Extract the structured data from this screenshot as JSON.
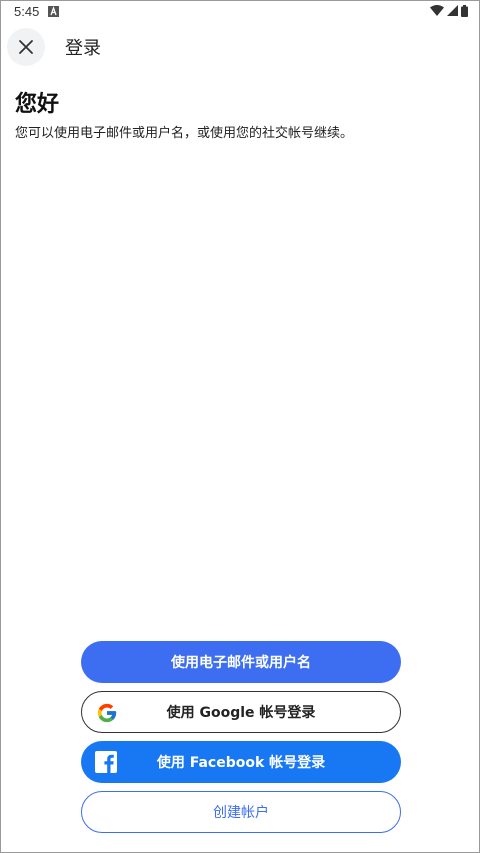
{
  "status_bar": {
    "time": "5:45",
    "notification_icon": "a-icon",
    "icons": [
      "wifi-icon",
      "signal-icon",
      "battery-icon"
    ]
  },
  "header": {
    "close_icon": "close-icon",
    "title": "登录"
  },
  "main": {
    "greeting": "您好",
    "subtitle": "您可以使用电子邮件或用户名，或使用您的社交帐号继续。"
  },
  "actions": {
    "email_label": "使用电子邮件或用户名",
    "google_label": "使用 Google 帐号登录",
    "facebook_label": "使用 Facebook 帐号登录",
    "create_label": "创建帐户"
  },
  "colors": {
    "primary": "#3d6ef2",
    "facebook": "#1877f2",
    "close_bg": "#f1f2f4"
  }
}
